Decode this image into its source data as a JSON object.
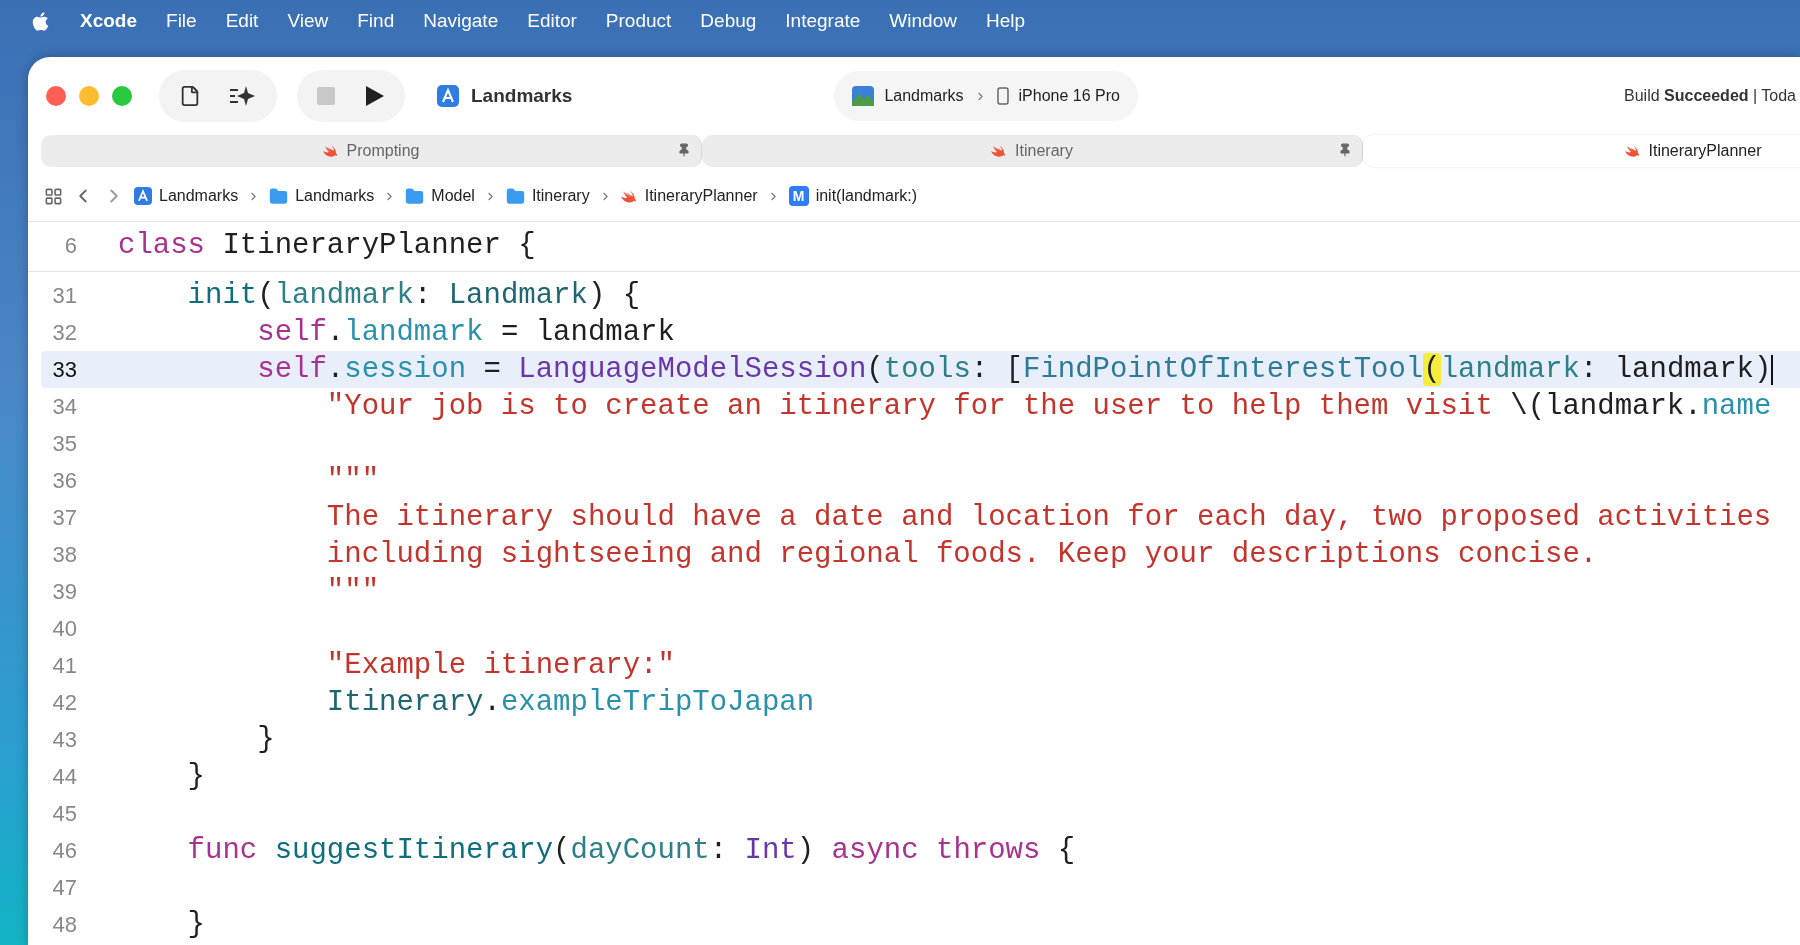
{
  "menu_bar": {
    "app_name": "Xcode",
    "menus": [
      "File",
      "Edit",
      "View",
      "Find",
      "Navigate",
      "Editor",
      "Product",
      "Debug",
      "Integrate",
      "Window",
      "Help"
    ]
  },
  "toolbar": {
    "project": "Landmarks",
    "scheme": "Landmarks",
    "device": "iPhone 16 Pro",
    "status": "Build **Succeeded** | Toda"
  },
  "tabs": [
    {
      "label": "Prompting",
      "pinned": true,
      "selected": false
    },
    {
      "label": "Itinerary",
      "pinned": true,
      "selected": false
    },
    {
      "label": "ItineraryPlanner",
      "pinned": false,
      "selected": true
    }
  ],
  "breadcrumbs": [
    {
      "label": "Landmarks",
      "kind": "project"
    },
    {
      "label": "Landmarks",
      "kind": "folder"
    },
    {
      "label": "Model",
      "kind": "folder"
    },
    {
      "label": "Itinerary",
      "kind": "folder"
    },
    {
      "label": "ItineraryPlanner",
      "kind": "swift"
    },
    {
      "label": "init(landmark:)",
      "kind": "method",
      "badge": "M"
    }
  ],
  "editor": {
    "sticky_line": {
      "number": "6",
      "current": false,
      "tokens": [
        {
          "kind": "keyword",
          "text": "class"
        },
        {
          "kind": "plain",
          "text": " ItineraryPlanner {"
        }
      ]
    },
    "lines": [
      {
        "number": "31",
        "current": false,
        "tokens": [
          {
            "kind": "decl",
            "text": "    init"
          },
          {
            "kind": "plain",
            "text": "("
          },
          {
            "kind": "param",
            "text": "landmark"
          },
          {
            "kind": "plain",
            "text": ": "
          },
          {
            "kind": "type",
            "text": "Landmark"
          },
          {
            "kind": "plain",
            "text": ") {"
          }
        ]
      },
      {
        "number": "32",
        "current": false,
        "tokens": [
          {
            "kind": "keyword",
            "text": "        self"
          },
          {
            "kind": "plain",
            "text": "."
          },
          {
            "kind": "property",
            "text": "landmark"
          },
          {
            "kind": "plain",
            "text": " = landmark"
          }
        ]
      },
      {
        "number": "33",
        "current": true,
        "tokens": [
          {
            "kind": "keyword",
            "text": "        self"
          },
          {
            "kind": "plain",
            "text": "."
          },
          {
            "kind": "property",
            "text": "session"
          },
          {
            "kind": "plain",
            "text": " = "
          },
          {
            "kind": "system_type",
            "text": "LanguageModelSession"
          },
          {
            "kind": "plain",
            "text": "("
          },
          {
            "kind": "param",
            "text": "tools"
          },
          {
            "kind": "plain",
            "text": ": ["
          },
          {
            "kind": "project_type",
            "text": "FindPointOfInterestTool"
          },
          {
            "kind": "match",
            "text": "("
          },
          {
            "kind": "param",
            "text": "landmark"
          },
          {
            "kind": "plain",
            "text": ": landmark)"
          }
        ]
      },
      {
        "number": "34",
        "current": false,
        "tokens": [
          {
            "kind": "string",
            "text": "            \"Your job is to create an itinerary for the user to help them visit "
          },
          {
            "kind": "plain",
            "text": "\\(landmark."
          },
          {
            "kind": "property",
            "text": "name"
          }
        ]
      },
      {
        "number": "35",
        "current": false
      },
      {
        "number": "36",
        "current": false,
        "tokens": [
          {
            "kind": "string",
            "text": "            \"\"\""
          }
        ]
      },
      {
        "number": "37",
        "current": false,
        "tokens": [
          {
            "kind": "string",
            "text": "            The itinerary should have a date and location for each day, two proposed activities"
          }
        ]
      },
      {
        "number": "38",
        "current": false,
        "tokens": [
          {
            "kind": "string",
            "text": "            including sightseeing and regional foods. Keep your descriptions concise."
          }
        ]
      },
      {
        "number": "39",
        "current": false,
        "tokens": [
          {
            "kind": "string",
            "text": "            \"\"\""
          }
        ]
      },
      {
        "number": "40",
        "current": false
      },
      {
        "number": "41",
        "current": false,
        "tokens": [
          {
            "kind": "string",
            "text": "            \"Example itinerary:\""
          }
        ]
      },
      {
        "number": "42",
        "current": false,
        "tokens": [
          {
            "kind": "type",
            "text": "            Itinerary"
          },
          {
            "kind": "plain",
            "text": "."
          },
          {
            "kind": "property",
            "text": "exampleTripToJapan"
          }
        ]
      },
      {
        "number": "43",
        "current": false,
        "tokens": [
          {
            "kind": "plain",
            "text": "        }"
          }
        ]
      },
      {
        "number": "44",
        "current": false,
        "tokens": [
          {
            "kind": "plain",
            "text": "    }"
          }
        ]
      },
      {
        "number": "45",
        "current": false
      },
      {
        "number": "46",
        "current": false,
        "tokens": [
          {
            "kind": "keyword",
            "text": "    func"
          },
          {
            "kind": "decl",
            "text": " suggestItinerary"
          },
          {
            "kind": "plain",
            "text": "("
          },
          {
            "kind": "param",
            "text": "dayCount"
          },
          {
            "kind": "plain",
            "text": ": "
          },
          {
            "kind": "system_type",
            "text": "Int"
          },
          {
            "kind": "plain",
            "text": ") "
          },
          {
            "kind": "keyword",
            "text": "async throws"
          },
          {
            "kind": "plain",
            "text": " {"
          }
        ]
      },
      {
        "number": "47",
        "current": false
      },
      {
        "number": "48",
        "current": false,
        "tokens": [
          {
            "kind": "plain",
            "text": "    }"
          }
        ]
      }
    ]
  }
}
